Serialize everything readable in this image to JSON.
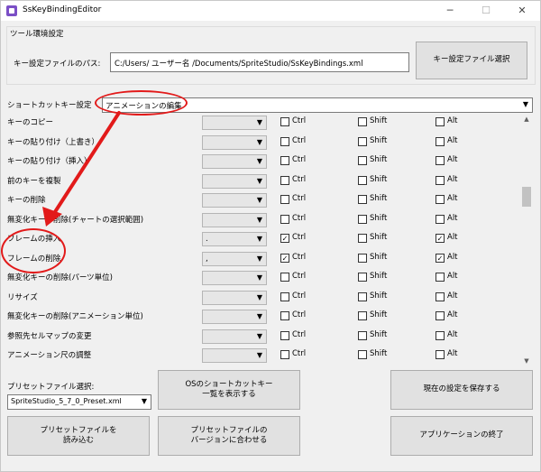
{
  "window": {
    "title": "SsKeyBindingEditor",
    "min": "─",
    "max": "☐",
    "close": "✕"
  },
  "tool_settings": {
    "group_title": "ツール環境設定",
    "path_label": "キー設定ファイルのパス:",
    "path_value": "C:/Users/   ユーザー名    /Documents/SpriteStudio/SsKeyBindings.xml",
    "select_button": "キー設定ファイル選択"
  },
  "shortcut": {
    "label": "ショートカットキー設定",
    "category": "アニメーションの編集",
    "dropdown_arrow": "▼"
  },
  "modifiers": {
    "ctrl": "Ctrl",
    "shift": "Shift",
    "alt": "Alt",
    "check_mark": "✓"
  },
  "rows": [
    {
      "name": "キーのコピー",
      "key": "",
      "ctrl": false,
      "shift": false,
      "alt": false
    },
    {
      "name": "キーの貼り付け（上書き）",
      "key": "",
      "ctrl": false,
      "shift": false,
      "alt": false
    },
    {
      "name": "キーの貼り付け（挿入）",
      "key": "",
      "ctrl": false,
      "shift": false,
      "alt": false
    },
    {
      "name": "前のキーを複製",
      "key": "",
      "ctrl": false,
      "shift": false,
      "alt": false
    },
    {
      "name": "キーの削除",
      "key": "",
      "ctrl": false,
      "shift": false,
      "alt": false
    },
    {
      "name": "無変化キーの削除(チャートの選択範囲)",
      "key": "",
      "ctrl": false,
      "shift": false,
      "alt": false
    },
    {
      "name": "フレームの挿入",
      "key": ".",
      "ctrl": true,
      "shift": false,
      "alt": true
    },
    {
      "name": "フレームの削除",
      "key": ",",
      "ctrl": true,
      "shift": false,
      "alt": true
    },
    {
      "name": "無変化キーの削除(パーツ単位)",
      "key": "",
      "ctrl": false,
      "shift": false,
      "alt": false
    },
    {
      "name": "リサイズ",
      "key": "",
      "ctrl": false,
      "shift": false,
      "alt": false
    },
    {
      "name": "無変化キーの削除(アニメーション単位)",
      "key": "",
      "ctrl": false,
      "shift": false,
      "alt": false
    },
    {
      "name": "参照先セルマップの変更",
      "key": "",
      "ctrl": false,
      "shift": false,
      "alt": false
    },
    {
      "name": "アニメーション尺の調整",
      "key": "",
      "ctrl": false,
      "shift": false,
      "alt": false
    }
  ],
  "scrollbar": {
    "up": "▲",
    "down": "▼"
  },
  "preset": {
    "label": "プリセットファイル選択:",
    "value": "SpriteStudio_5_7_0_Preset.xml"
  },
  "buttons": {
    "show_list": "OSのショートカットキー\n一覧を表示する",
    "save": "現在の設定を保存する",
    "load_preset": "プリセットファイルを\n読み込む",
    "match_version": "プリセットファイルの\nバージョンに合わせる",
    "exit": "アプリケーションの終了"
  },
  "annotation_color": "#e21a1a"
}
